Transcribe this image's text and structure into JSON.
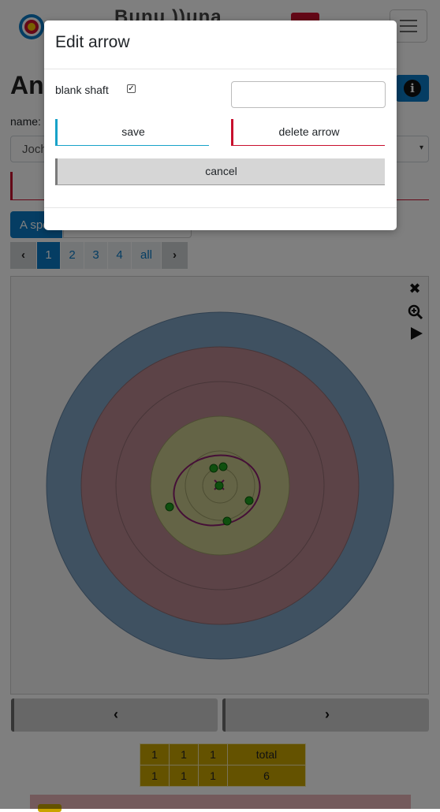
{
  "navbar": {
    "brand": "Bunu ))una",
    "logo_icon": "archery-target-logo",
    "menu_icon": "hamburger-icon"
  },
  "page": {
    "title": "Ana",
    "info_icon": "info-icon"
  },
  "name_field": {
    "label": "name:",
    "value": "Joch",
    "caret": "▾"
  },
  "mode": {
    "active_label": "A spe"
  },
  "pager": {
    "prev": "‹",
    "pages": [
      "1",
      "2",
      "3",
      "4",
      "all"
    ],
    "active": "1",
    "next": "›"
  },
  "target_tools": {
    "tool_icon": "tools-icon",
    "zoom_icon": "zoom-in-icon",
    "play_icon": "play-icon"
  },
  "target": {
    "ring_colors": {
      "blue": "#7fa3c3",
      "red": "#b9878e",
      "gold": "#c9c98c",
      "bg": "#f2f2f2"
    },
    "group_ellipse_color": "#8b1f6e",
    "hit_color": "#1fa01f"
  },
  "nav": {
    "prev": "‹",
    "next": "›"
  },
  "score_table": {
    "header": [
      "1",
      "1",
      "1",
      "total"
    ],
    "row": [
      "1",
      "1",
      "1",
      "6"
    ]
  },
  "modal": {
    "title": "Edit arrow",
    "checkbox_label": "blank shaft",
    "checkbox_checked": true,
    "checkbox_mark": "✓",
    "text_value": "",
    "save_label": "save",
    "delete_label": "delete arrow",
    "cancel_label": "cancel"
  }
}
